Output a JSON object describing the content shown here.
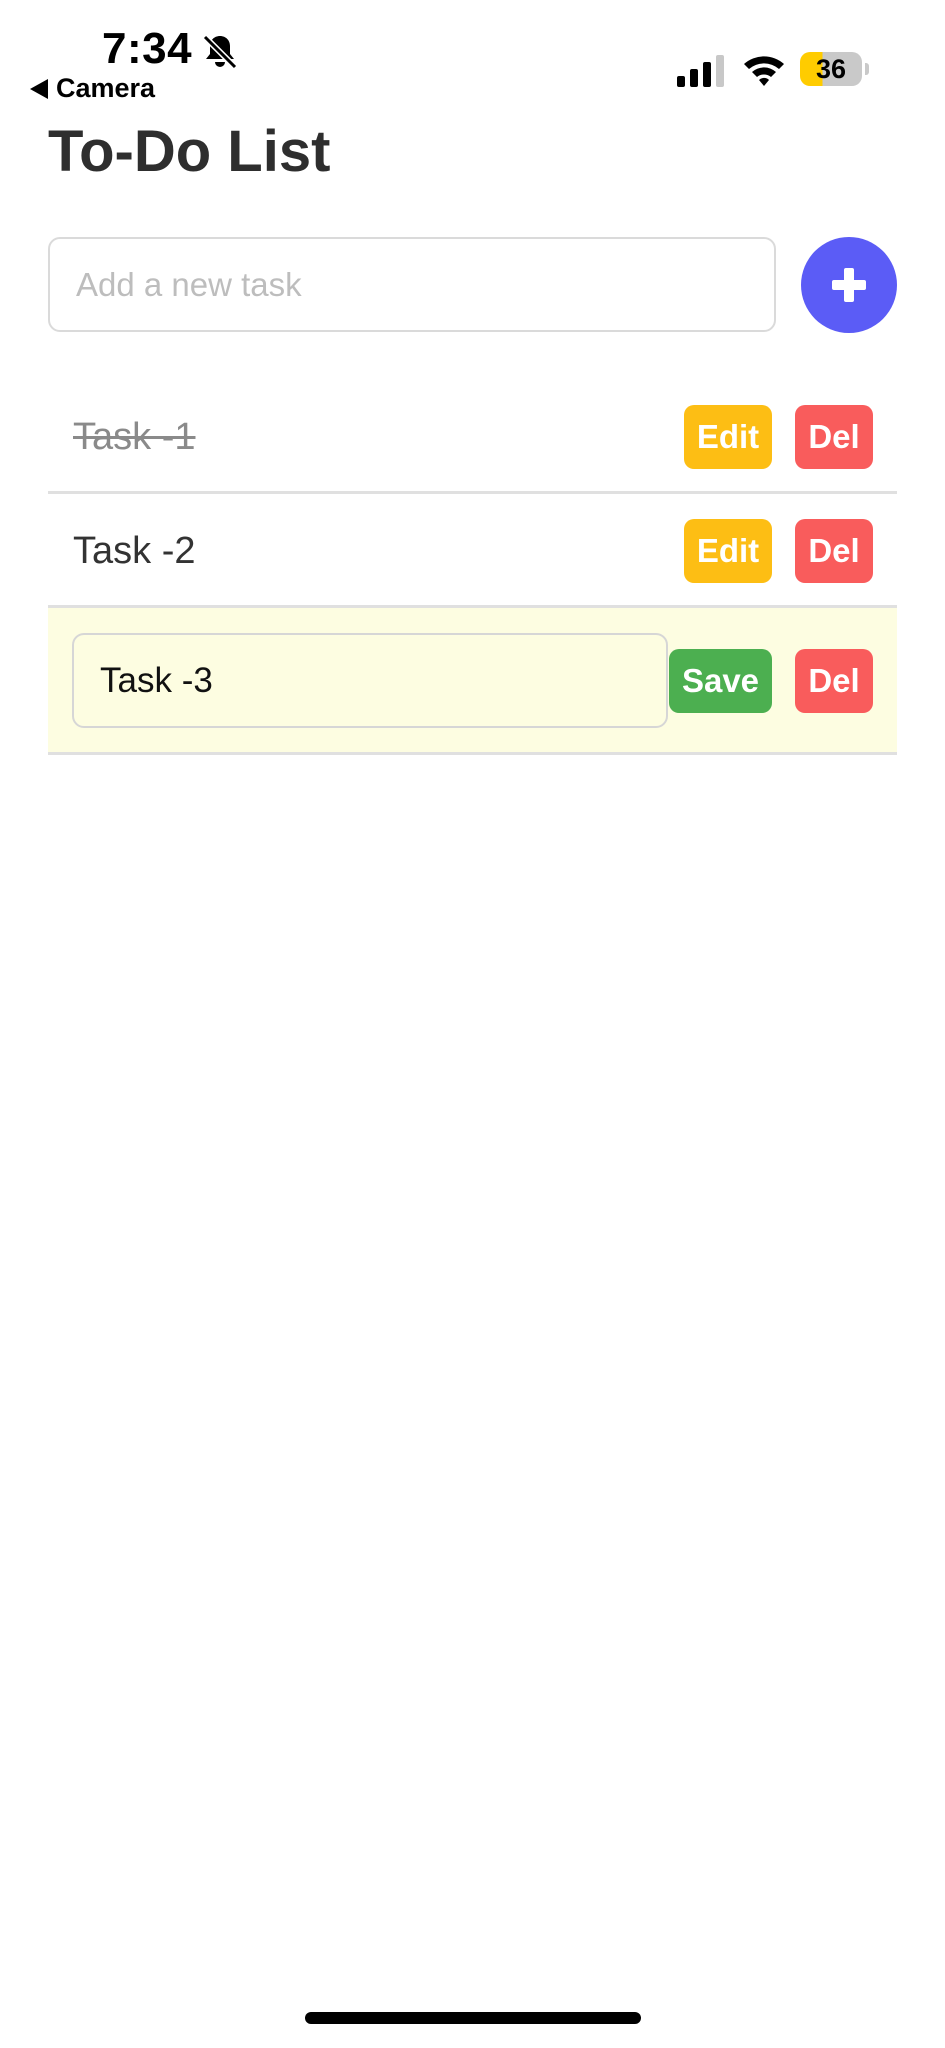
{
  "status_bar": {
    "time": "7:34",
    "back_label": "Camera",
    "battery_level": "36",
    "battery_color": "#ffcc00",
    "icons": [
      "bell-slash-icon",
      "back-arrow-icon",
      "cellular-signal-icon",
      "wifi-icon",
      "battery-icon"
    ]
  },
  "header": {
    "title": "To-Do List"
  },
  "new_task": {
    "placeholder": "Add a new task",
    "value": "",
    "add_icon": "plus-icon",
    "add_color": "#5b5cf6"
  },
  "tasks": [
    {
      "text": "Task -1",
      "completed": true,
      "editing": false,
      "edit_label": "Edit",
      "delete_label": "Del"
    },
    {
      "text": "Task -2",
      "completed": false,
      "editing": false,
      "edit_label": "Edit",
      "delete_label": "Del"
    },
    {
      "text": "Task -3",
      "completed": false,
      "editing": true,
      "save_label": "Save",
      "delete_label": "Del"
    }
  ],
  "colors": {
    "edit": "#fdbe14",
    "delete": "#f95c5c",
    "save": "#4caf50",
    "editing_row_bg": "#fdfde1"
  }
}
